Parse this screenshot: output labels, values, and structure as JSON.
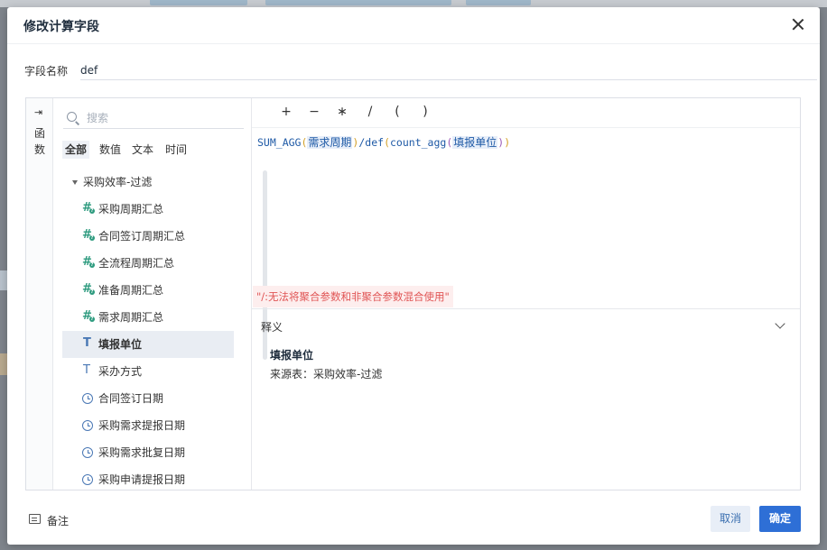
{
  "dialog": {
    "title": "修改计算字段",
    "close_icon": "close-icon"
  },
  "field_name": {
    "label": "字段名称",
    "value": "def"
  },
  "func_tab": {
    "icon": "arrow-right-icon",
    "label_line1": "函",
    "label_line2": "数"
  },
  "search": {
    "placeholder": "搜索"
  },
  "filters": [
    {
      "label": "全部",
      "active": true
    },
    {
      "label": "数值",
      "active": false
    },
    {
      "label": "文本",
      "active": false
    },
    {
      "label": "时间",
      "active": false
    }
  ],
  "tree": {
    "group": "采购效率-过滤",
    "items": [
      {
        "label": "采购周期汇总",
        "icon": "calc-field-icon"
      },
      {
        "label": "合同签订周期汇总",
        "icon": "calc-field-icon"
      },
      {
        "label": "全流程周期汇总",
        "icon": "calc-field-icon"
      },
      {
        "label": "准备周期汇总",
        "icon": "calc-field-icon"
      },
      {
        "label": "需求周期汇总",
        "icon": "calc-field-icon"
      },
      {
        "label": "填报单位",
        "icon": "text-type-icon",
        "selected": true
      },
      {
        "label": "采办方式",
        "icon": "text-type-icon"
      },
      {
        "label": "合同签订日期",
        "icon": "clock-icon"
      },
      {
        "label": "采购需求提报日期",
        "icon": "clock-icon"
      },
      {
        "label": "采购需求批复日期",
        "icon": "clock-icon"
      },
      {
        "label": "采购申请提报日期",
        "icon": "clock-icon"
      }
    ]
  },
  "operators": [
    "+",
    "−",
    "∗",
    "/",
    "(",
    ")"
  ],
  "formula": {
    "fn1": "SUM_AGG",
    "field1": "需求周期",
    "op": "/def",
    "fn2": "count_agg",
    "field2": "填报单位"
  },
  "error": "\"/:无法将聚合参数和非聚合参数混合使用\"",
  "explain": {
    "title": "释义",
    "field": "填报单位",
    "source": "来源表：采购效率-过滤"
  },
  "footer": {
    "note_label": "备注",
    "cancel_label": "取消",
    "ok_label": "确定"
  }
}
